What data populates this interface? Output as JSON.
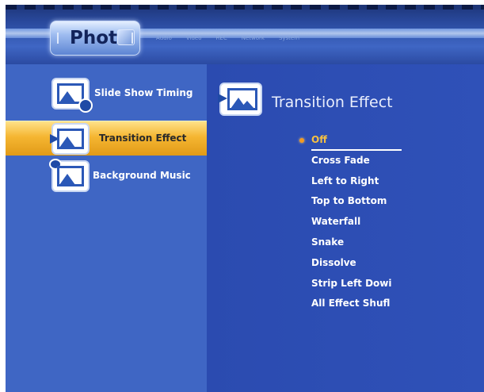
{
  "header": {
    "active_tab": "Photo",
    "other_tabs": [
      "Audio",
      "Video",
      "REC",
      "Network",
      "System"
    ]
  },
  "sidebar": {
    "items": [
      {
        "label": "Slide Show Timing",
        "icon": "clock-photo-icon",
        "active": false
      },
      {
        "label": "Transition Effect",
        "icon": "transition-photo-icon",
        "active": true
      },
      {
        "label": "Background Music",
        "icon": "music-photo-icon",
        "active": false
      }
    ]
  },
  "main": {
    "title": "Transition Effect",
    "options": [
      "Off",
      "Cross Fade",
      "Left to Right",
      "Top to Bottom",
      "Waterfall",
      "Snake",
      "Dissolve",
      "Strip Left Dowi",
      "All Effect Shufl"
    ],
    "selected_index": 0
  },
  "colors": {
    "background": "#3b5fb6",
    "highlight": "#f5b632",
    "selected_text": "#f5c142"
  }
}
